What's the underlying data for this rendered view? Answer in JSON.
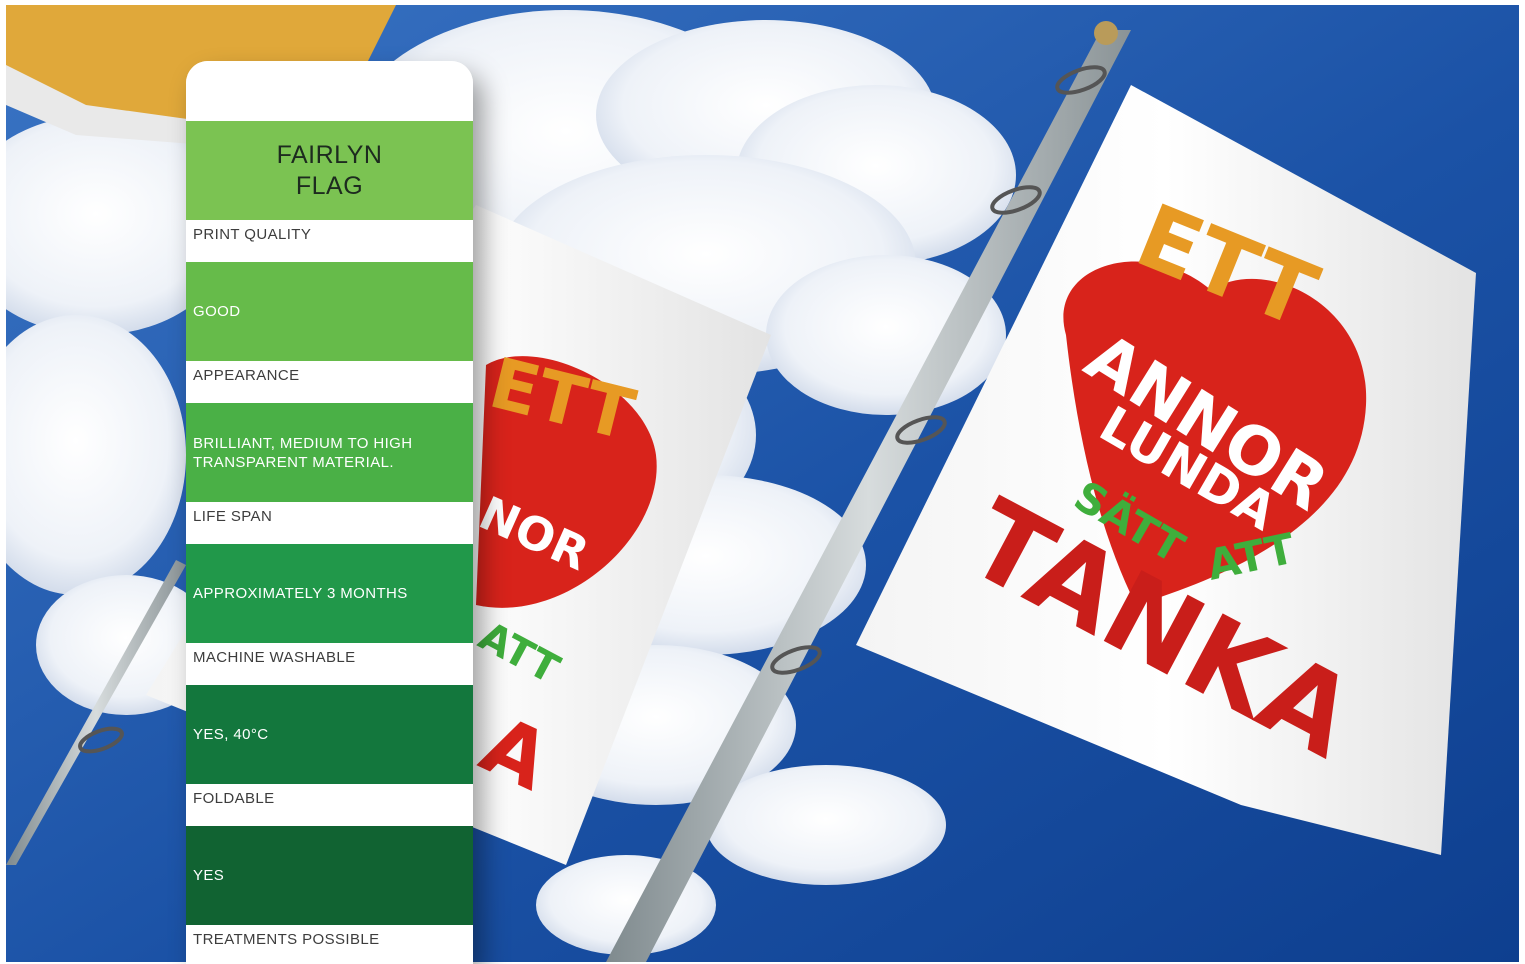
{
  "product": {
    "title_line1": "FAIRLYN",
    "title_line2": "FLAG"
  },
  "specs": [
    {
      "label": "PRINT QUALITY",
      "value": "GOOD",
      "color": "#66bb4a"
    },
    {
      "label": "APPEARANCE",
      "value": "BRILLIANT, MEDIUM TO HIGH TRANSPARENT MATERIAL.",
      "color": "#4ab046"
    },
    {
      "label": "LIFE SPAN",
      "value": "APPROXIMATELY 3 MONTHS",
      "color": "#21984a"
    },
    {
      "label": "MACHINE WASHABLE",
      "value": "YES, 40°C",
      "color": "#13773d"
    },
    {
      "label": "FOLDABLE",
      "value": "YES",
      "color": "#116332"
    },
    {
      "label": "TREATMENTS POSSIBLE",
      "value": "",
      "color": "#ffffff"
    }
  ],
  "flag_text": {
    "ett": "ETT",
    "annor": "ANNOR",
    "lunda": "LUNDA",
    "satt": "SÄTT",
    "att": "ATT",
    "tanka": "TANKA"
  },
  "colors": {
    "sky": "#1d55a8",
    "title_band": "#7bc352",
    "heart_red": "#d8231b",
    "letter_orange": "#e79a24",
    "letter_green": "#3fae3c"
  }
}
